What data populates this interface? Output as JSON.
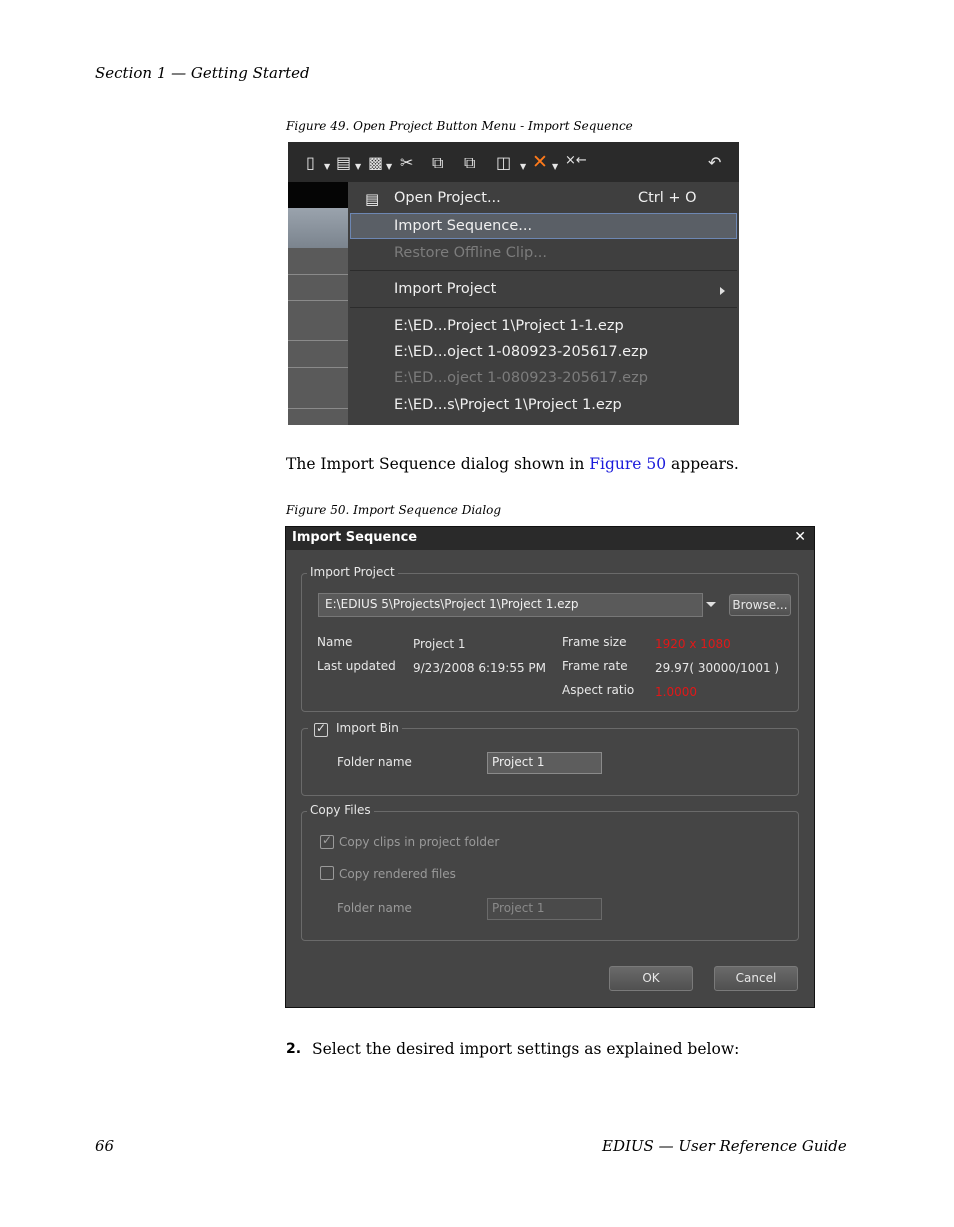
{
  "header": {
    "section": "Section 1 — Getting Started"
  },
  "fig49": {
    "caption": "Figure 49.  Open Project Button Menu - Import Sequence",
    "menu": {
      "open_project": "Open Project...",
      "open_shortcut": "Ctrl + O",
      "import_sequence": "Import Sequence...",
      "restore_offline": "Restore Offline Clip...",
      "import_project": "Import Project",
      "recent": [
        "E:\\ED...Project 1\\Project 1-1.ezp",
        "E:\\ED...oject 1-080923-205617.ezp",
        "E:\\ED...oject 1-080923-205617.ezp",
        "E:\\ED...s\\Project 1\\Project 1.ezp"
      ]
    }
  },
  "body": {
    "intro_before": "The Import Sequence dialog shown in ",
    "intro_link": "Figure 50",
    "intro_after": " appears."
  },
  "fig50": {
    "caption": "Figure 50.  Import Sequence Dialog",
    "title": "Import Sequence",
    "import_project": {
      "legend": "Import Project",
      "path": "E:\\EDIUS 5\\Projects\\Project 1\\Project 1.ezp",
      "browse": "Browse...",
      "name_label": "Name",
      "name_value": "Project 1",
      "updated_label": "Last updated",
      "updated_value": "9/23/2008 6:19:55 PM",
      "frame_size_label": "Frame size",
      "frame_size_value": "1920 x 1080",
      "frame_rate_label": "Frame rate",
      "frame_rate_value": "29.97( 30000/1001 )",
      "aspect_label": "Aspect ratio",
      "aspect_value": "1.0000"
    },
    "import_bin": {
      "legend": "Import Bin",
      "folder_label": "Folder name",
      "folder_value": "Project 1"
    },
    "copy_files": {
      "legend": "Copy Files",
      "copy_clips": "Copy clips in project folder",
      "copy_rendered": "Copy rendered files",
      "folder_label": "Folder name",
      "folder_value": "Project 1"
    },
    "ok": "OK",
    "cancel": "Cancel"
  },
  "step": {
    "number": "2.",
    "text": "Select the desired import settings as explained below:"
  },
  "footer": {
    "page": "66",
    "guide": "EDIUS  —  User Reference Guide"
  }
}
